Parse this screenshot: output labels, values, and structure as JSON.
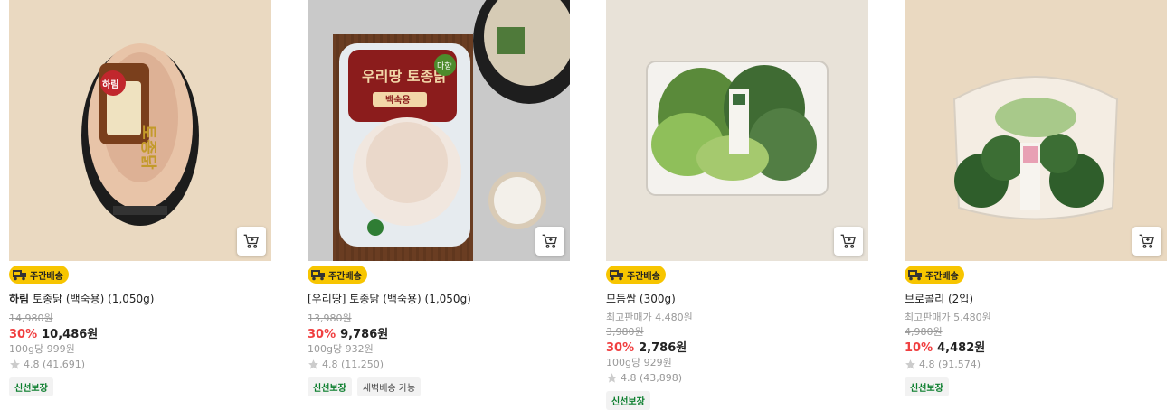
{
  "products": [
    {
      "brand": "하림",
      "name": " 토종닭 (백숙용) (1,050g)",
      "original_price": "14,980원",
      "discount": "30%",
      "price": "10,486원",
      "unit_price": "100g당 999원",
      "rating": "4.8 (41,691)",
      "delivery_badge": "주간배송",
      "tags": [
        "신선보장"
      ]
    },
    {
      "brand": "",
      "name": "[우리땅] 토종닭 (백숙용) (1,050g)",
      "original_price": "13,980원",
      "discount": "30%",
      "price": "9,786원",
      "unit_price": "100g당 932원",
      "rating": "4.8 (11,250)",
      "delivery_badge": "주간배송",
      "tags": [
        "신선보장",
        "새벽배송 가능"
      ]
    },
    {
      "brand": "",
      "name": "모둠쌈 (300g)",
      "max_price_note": "최고판매가 4,480원",
      "original_price": "3,980원",
      "discount": "30%",
      "price": "2,786원",
      "unit_price": "100g당 929원",
      "rating": "4.8 (43,898)",
      "delivery_badge": "주간배송",
      "tags": [
        "신선보장"
      ]
    },
    {
      "brand": "",
      "name": "브로콜리 (2입)",
      "max_price_note": "최고판매가 5,480원",
      "original_price": "4,980원",
      "discount": "10%",
      "price": "4,482원",
      "unit_price": "",
      "rating": "4.8 (91,574)",
      "delivery_badge": "주간배송",
      "tags": [
        "신선보장"
      ]
    }
  ],
  "package_text": {
    "harim_logo": "하림",
    "harim_label": "토종닭",
    "uridang_label": "우리땅 토종닭",
    "uridang_sub": "백숙용",
    "uridang_badge": "다향"
  },
  "icons": {
    "cart": "cart-icon",
    "truck": "delivery-truck-icon",
    "star": "star-icon"
  },
  "colors": {
    "discount": "#f03f40",
    "badge": "#f7c500",
    "fresh_tag": "#0a7d2c"
  }
}
